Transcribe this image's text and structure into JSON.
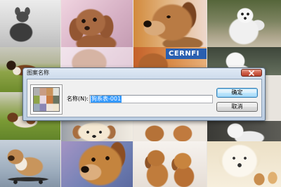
{
  "window": {
    "title": "图案名称"
  },
  "dialog": {
    "name_label": "名称(N):",
    "name_value": "狗系表-001",
    "ok_label": "确定",
    "cancel_label": "取消"
  },
  "photo_lettering": "CERNFI",
  "icons": {
    "close": "close-icon"
  },
  "colors": {
    "selection": "#3399ff",
    "close_button": "#c75040",
    "dialog_frame": "#c9d8e9",
    "dialog_body": "#f0f0f0"
  }
}
